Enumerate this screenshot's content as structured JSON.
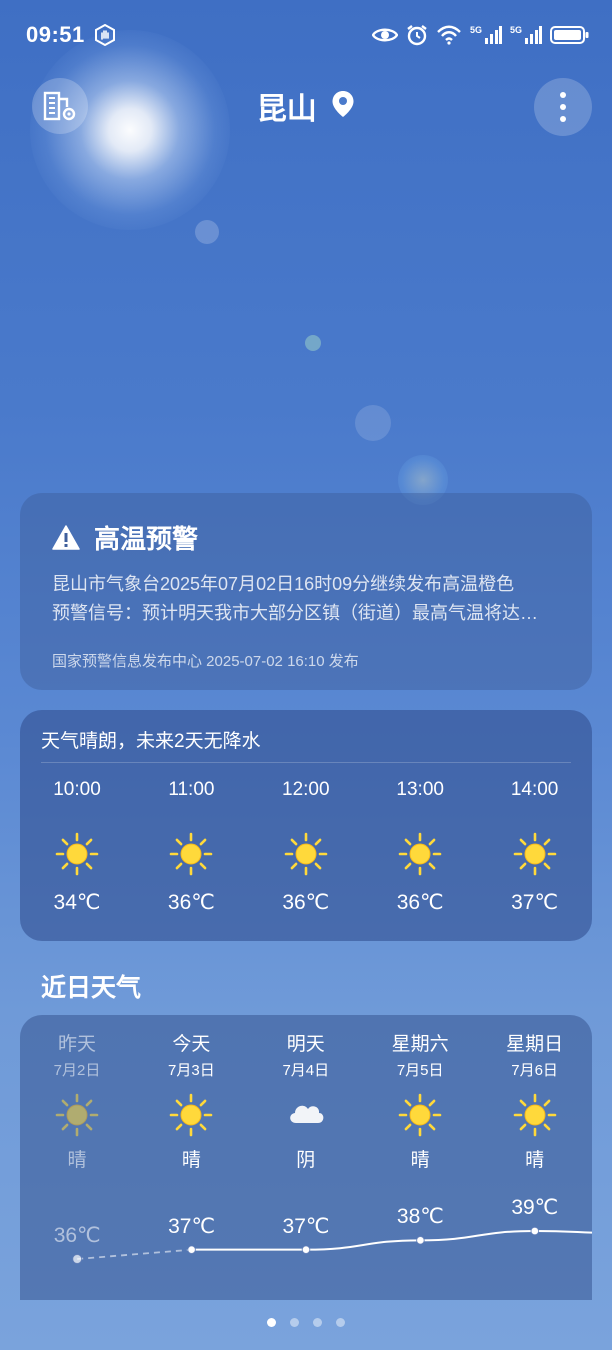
{
  "status_bar": {
    "time": "09:51",
    "signal1": "5G",
    "signal2": "5G"
  },
  "header": {
    "city": "昆山",
    "icons": [
      "city-manage-icon",
      "location-pin-icon",
      "more-vertical-icon"
    ]
  },
  "warning": {
    "title": "高温预警",
    "line1": "昆山市气象台2025年07月02日16时09分继续发布高温橙色",
    "line2": "预警信号：预计明天我市大部分区镇（街道）最高气温将达…",
    "source": "国家预警信息发布中心 2025-07-02 16:10 发布"
  },
  "hourly": {
    "summary": "天气晴朗，未来2天无降水",
    "hours": [
      {
        "time": "10:00",
        "icon": "sun-icon",
        "temp": "34℃"
      },
      {
        "time": "11:00",
        "icon": "sun-icon",
        "temp": "36℃"
      },
      {
        "time": "12:00",
        "icon": "sun-icon",
        "temp": "36℃"
      },
      {
        "time": "13:00",
        "icon": "sun-icon",
        "temp": "36℃"
      },
      {
        "time": "14:00",
        "icon": "sun-icon",
        "temp": "37℃"
      }
    ]
  },
  "daily": {
    "title": "近日天气",
    "days": [
      {
        "name": "昨天",
        "date": "7月2日",
        "icon": "sun-icon",
        "cond": "晴",
        "high": "36℃",
        "high_value": 36
      },
      {
        "name": "今天",
        "date": "7月3日",
        "icon": "sun-icon",
        "cond": "晴",
        "high": "37℃",
        "high_value": 37
      },
      {
        "name": "明天",
        "date": "7月4日",
        "icon": "cloud-icon",
        "cond": "阴",
        "high": "37℃",
        "high_value": 37
      },
      {
        "name": "星期六",
        "date": "7月5日",
        "icon": "sun-icon",
        "cond": "晴",
        "high": "38℃",
        "high_value": 38
      },
      {
        "name": "星期日",
        "date": "7月6日",
        "icon": "sun-icon",
        "cond": "晴",
        "high": "39℃",
        "high_value": 39
      }
    ]
  },
  "pager": {
    "count": 4,
    "active": 1
  },
  "colors": {
    "sun": "#ffd93b",
    "sun_stroke": "#f6b919"
  }
}
